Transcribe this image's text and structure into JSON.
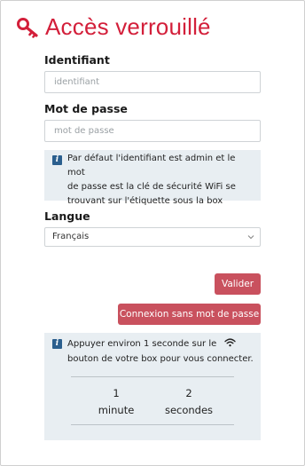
{
  "header": {
    "title": "Accès verrouillé",
    "icon": "key-icon",
    "accent_color": "#d31f3a"
  },
  "form": {
    "identifier_label": "Identifiant",
    "identifier_placeholder": "identifiant",
    "identifier_value": "",
    "password_label": "Mot de passe",
    "password_placeholder": "mot de passe",
    "password_value": "",
    "default_info": {
      "icon": "info-icon",
      "line1": "Par défaut l'identifiant est admin et le mot",
      "line2": "de passe est la clé de sécurité WiFi se",
      "line3": "trouvant sur l'étiquette sous la box"
    },
    "language_label": "Langue",
    "language_selected": "Français",
    "submit_label": "Valider",
    "passwordless_label": "Connexion sans mot de passe",
    "button_color": "#c9515e"
  },
  "wps_info": {
    "icon": "info-icon",
    "line1": "Appuyer environ 1 seconde sur le",
    "line2": "bouton de votre box pour vous connecter.",
    "wifi_icon": "wifi-icon",
    "minutes_value": "1",
    "minutes_unit": "minute",
    "seconds_value": "2",
    "seconds_unit": "secondes"
  }
}
